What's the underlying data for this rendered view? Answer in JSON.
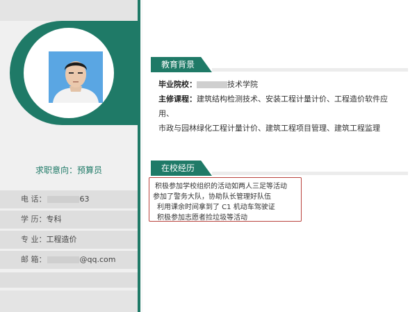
{
  "left": {
    "job_intent_label": "求职意向：",
    "job_intent_value": "预算员",
    "info": [
      {
        "label": "电  话：",
        "value": "63"
      },
      {
        "label": "学  历：",
        "value": "专科"
      },
      {
        "label": "专  业：",
        "value": "工程造价"
      },
      {
        "label": "邮  箱：",
        "value": "@qq.com"
      }
    ]
  },
  "education": {
    "title": "教育背景",
    "school_label": "毕业院校：",
    "school_value": "技术学院",
    "courses_label": "主修课程：",
    "courses_line1": "建筑结构检测技术、安装工程计量计价、工程造价软件应用、",
    "courses_line2": "市政与园林绿化工程计量计价、建筑工程项目管理、建筑工程监理"
  },
  "experience": {
    "title": "在校经历",
    "items": [
      "积极参加学校组织的活动如两人三足等活动",
      "参加了警务大队，协助队长管理好队伍",
      "利用课余时间拿到了 C1 机动车驾驶证",
      "积极参加志愿者捡垃圾等活动"
    ]
  },
  "colors": {
    "accent": "#1f7a67",
    "highlight_border": "#b9433d"
  }
}
